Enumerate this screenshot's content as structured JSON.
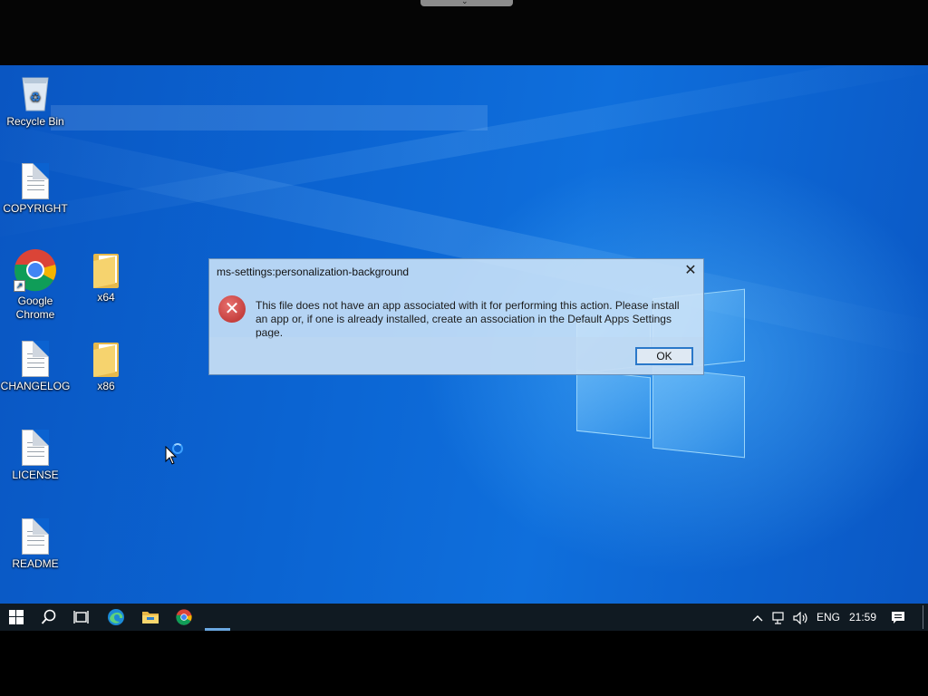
{
  "desktop": {
    "icons": [
      {
        "label": "Recycle Bin",
        "icon": "recycle-bin-icon"
      },
      {
        "label": "COPYRIGHT",
        "icon": "document-icon"
      },
      {
        "label": "Google Chrome",
        "icon": "chrome-icon"
      },
      {
        "label": "x64",
        "icon": "folder-icon"
      },
      {
        "label": "CHANGELOG",
        "icon": "document-icon"
      },
      {
        "label": "x86",
        "icon": "folder-icon"
      },
      {
        "label": "LICENSE",
        "icon": "document-icon"
      },
      {
        "label": "README",
        "icon": "document-icon"
      }
    ]
  },
  "dialog": {
    "title": "ms-settings:personalization-background",
    "close": "✕",
    "icon": "error-icon",
    "message": "This file does not have an app associated with it for performing this action. Please install an app or, if one is already installed, create an association in the Default Apps Settings page.",
    "ok_label": "OK"
  },
  "taskbar": {
    "apps": [
      "start-icon",
      "search-icon",
      "task-view-icon",
      "edge-icon",
      "file-explorer-icon",
      "chrome-icon"
    ],
    "tray": {
      "chevron": "^",
      "language": "ENG",
      "time": "21:59"
    }
  },
  "colors": {
    "desktop": "#0b64d2",
    "taskbar": "#101a22",
    "dialog_bg": "#cde4f8",
    "error": "#c5403e",
    "accent": "#2a78c9"
  }
}
